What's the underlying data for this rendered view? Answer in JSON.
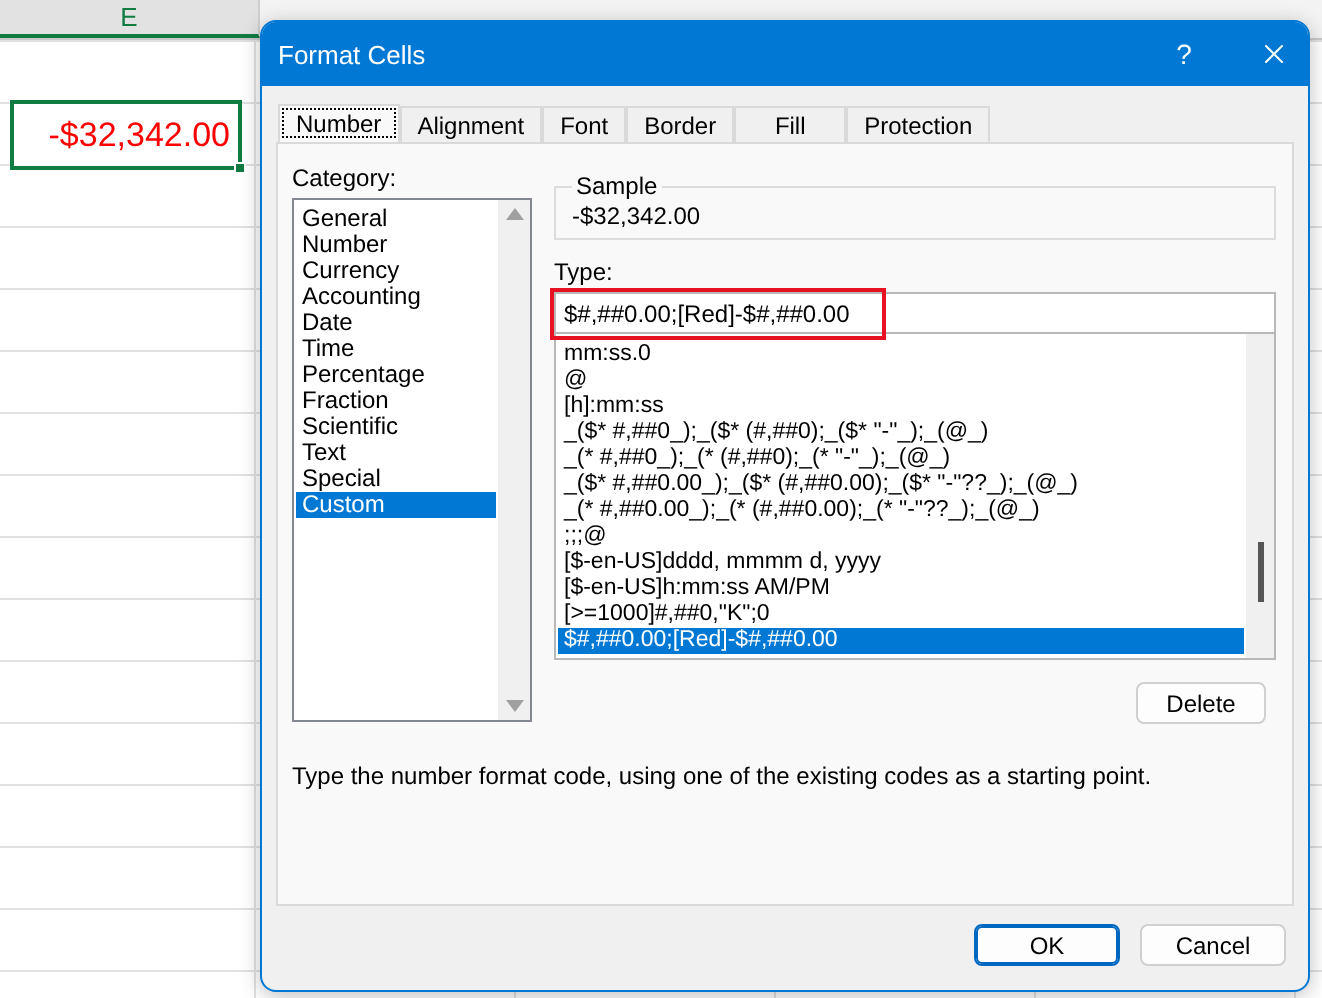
{
  "spreadsheet": {
    "columns": [
      {
        "label": "E",
        "selected": true
      }
    ],
    "selected_cell": {
      "value": "-$32,342.00"
    }
  },
  "dialog": {
    "title": "Format Cells",
    "help": "?",
    "tabs": [
      {
        "label": "Number",
        "selected": true
      },
      {
        "label": "Alignment",
        "selected": false
      },
      {
        "label": "Font",
        "selected": false
      },
      {
        "label": "Border",
        "selected": false
      },
      {
        "label": "Fill",
        "selected": false
      },
      {
        "label": "Protection",
        "selected": false
      }
    ],
    "category_label": "Category:",
    "categories": [
      {
        "label": "General",
        "selected": false
      },
      {
        "label": "Number",
        "selected": false
      },
      {
        "label": "Currency",
        "selected": false
      },
      {
        "label": "Accounting",
        "selected": false
      },
      {
        "label": "Date",
        "selected": false
      },
      {
        "label": "Time",
        "selected": false
      },
      {
        "label": "Percentage",
        "selected": false
      },
      {
        "label": "Fraction",
        "selected": false
      },
      {
        "label": "Scientific",
        "selected": false
      },
      {
        "label": "Text",
        "selected": false
      },
      {
        "label": "Special",
        "selected": false
      },
      {
        "label": "Custom",
        "selected": true
      }
    ],
    "sample": {
      "label": "Sample",
      "value": "-$32,342.00"
    },
    "type": {
      "label": "Type:",
      "value": "$#,##0.00;[Red]-$#,##0.00",
      "highlighted": true
    },
    "formats": [
      {
        "label": "mm:ss.0",
        "selected": false
      },
      {
        "label": "@",
        "selected": false
      },
      {
        "label": "[h]:mm:ss",
        "selected": false
      },
      {
        "label": "_($* #,##0_);_($* (#,##0);_($* \"-\"_);_(@_)",
        "selected": false
      },
      {
        "label": "_(* #,##0_);_(* (#,##0);_(* \"-\"_);_(@_)",
        "selected": false
      },
      {
        "label": "_($* #,##0.00_);_($* (#,##0.00);_($* \"-\"??_);_(@_)",
        "selected": false
      },
      {
        "label": "_(* #,##0.00_);_(* (#,##0.00);_(* \"-\"??_);_(@_)",
        "selected": false
      },
      {
        "label": ";;;@",
        "selected": false
      },
      {
        "label": "[$-en-US]dddd, mmmm d, yyyy",
        "selected": false
      },
      {
        "label": "[$-en-US]h:mm:ss AM/PM",
        "selected": false
      },
      {
        "label": "[>=1000]#,##0,\"K\";0",
        "selected": false
      },
      {
        "label": "$#,##0.00;[Red]-$#,##0.00",
        "selected": true
      }
    ],
    "delete_button": "Delete",
    "description": "Type the number format code, using one of the existing codes as a starting point.",
    "buttons": [
      {
        "label": "OK",
        "kind": "primary"
      },
      {
        "label": "Cancel",
        "kind": "secondary"
      }
    ]
  }
}
